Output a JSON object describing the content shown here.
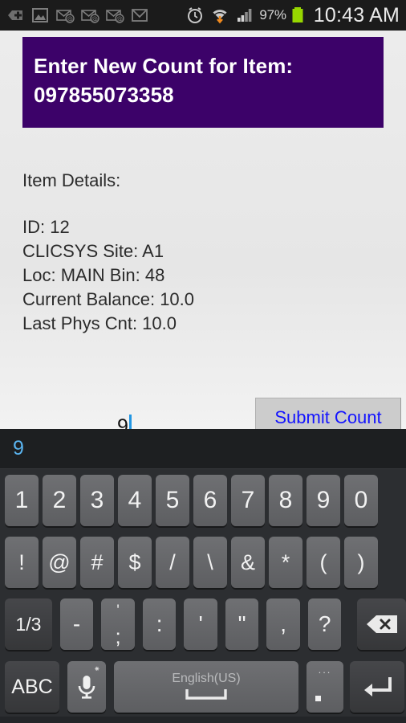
{
  "statusbar": {
    "left_icons": [
      {
        "name": "add-tag-icon",
        "glyph": "+"
      },
      {
        "name": "gallery-image-icon",
        "glyph": "image"
      },
      {
        "name": "email-unread-icon-1",
        "glyph": "mail-at"
      },
      {
        "name": "email-unread-icon-2",
        "glyph": "mail-at"
      },
      {
        "name": "email-unread-icon-3",
        "glyph": "mail-at"
      },
      {
        "name": "gmail-icon",
        "glyph": "M"
      }
    ],
    "alarm_icon": "alarm-clock-icon",
    "wifi_icon": "wifi-download-icon",
    "signal_icon": "cellular-signal-icon",
    "battery_percent": "97%",
    "battery_icon": "battery-full-icon",
    "battery_color": "#97d700",
    "clock": "10:43 AM"
  },
  "app": {
    "header": {
      "line1": "Enter New Count for Item:",
      "line2": "097855073358",
      "background_color": "#3c0269",
      "text_color": "#ffffff"
    },
    "details": {
      "title": "Item Details:",
      "lines": [
        "ID: 12",
        "CLICSYS Site: A1",
        "Loc: MAIN Bin: 48",
        "Current Balance: 10.0",
        "Last Phys Cnt: 10.0"
      ]
    },
    "count_input": {
      "value": "9",
      "placeholder": "",
      "accent_color": "#2196e3"
    },
    "submit_button": {
      "label": "Submit Count",
      "text_color": "#1414ff",
      "background_color": "#cccccc"
    }
  },
  "keyboard": {
    "suggestion": "9",
    "suggestion_color": "#5ab4f0",
    "number_row": [
      "1",
      "2",
      "3",
      "4",
      "5",
      "6",
      "7",
      "8",
      "9",
      "0"
    ],
    "symbol_row": [
      "!",
      "@",
      "#",
      "$",
      "/",
      "\\",
      "&",
      "*",
      "(",
      ")"
    ],
    "punctuation_row": {
      "mode_key": "1/3",
      "keys": [
        {
          "top": "",
          "bottom": "-",
          "single": "-"
        },
        {
          "top": "'",
          "bottom": ";",
          "single": ""
        },
        {
          "top": ":",
          "bottom": ":",
          "single": ":"
        },
        {
          "top": "'",
          "bottom": "",
          "single": "'"
        },
        {
          "top": "\"",
          "bottom": "",
          "single": "\""
        },
        {
          "top": "",
          "bottom": ",",
          "single": ","
        },
        {
          "top": "",
          "bottom": "?",
          "single": "?"
        }
      ],
      "backspace_icon": "backspace-icon"
    },
    "bottom_row": {
      "abc_key": "ABC",
      "mic_icon": "microphone-icon",
      "space_label": "English(US)",
      "space_icon": "spacebar-icon",
      "period_key": ".",
      "period_dots": "...",
      "enter_icon": "enter-return-icon"
    }
  }
}
